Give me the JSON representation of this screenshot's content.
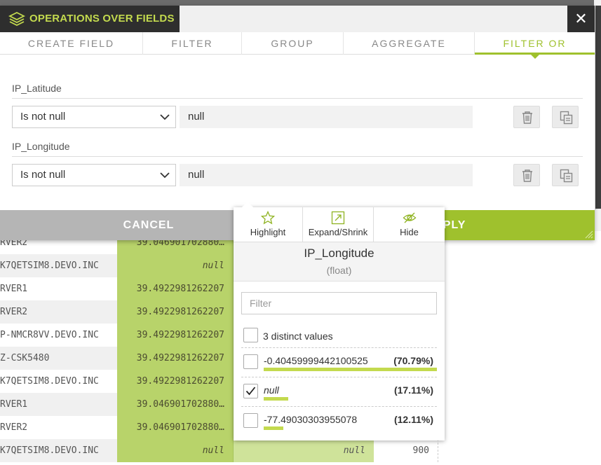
{
  "modal": {
    "title": "OPERATIONS OVER FIELDS",
    "close_symbol": "✕",
    "tabs": [
      {
        "label": "CREATE FIELD",
        "active": false
      },
      {
        "label": "FILTER",
        "active": false
      },
      {
        "label": "GROUP",
        "active": false
      },
      {
        "label": "AGGREGATE",
        "active": false
      },
      {
        "label": "FILTER OR",
        "active": true
      }
    ],
    "filters": [
      {
        "field": "IP_Latitude",
        "operator": "Is not null",
        "value": "null"
      },
      {
        "field": "IP_Longitude",
        "operator": "Is not null",
        "value": "null"
      }
    ],
    "cancel_label": "CANCEL",
    "apply_label": "APPLY"
  },
  "popover": {
    "actions": {
      "highlight": "Highlight",
      "expand": "Expand/Shrink",
      "hide": "Hide"
    },
    "field_name": "IP_Longitude",
    "field_type": "(float)",
    "filter_placeholder": "Filter",
    "distinct_label": "3 distinct values",
    "values": [
      {
        "value": "-0.40459999442100525",
        "percent": "(70.79%)",
        "fraction": 0.7079,
        "checked": false,
        "italic": false
      },
      {
        "value": "null",
        "percent": "(17.11%)",
        "fraction": 0.1711,
        "checked": true,
        "italic": true
      },
      {
        "value": "-77.49030303955078",
        "percent": "(12.11%)",
        "fraction": 0.1211,
        "checked": false,
        "italic": false
      }
    ]
  },
  "grid": {
    "rows": [
      {
        "host": "RVER2",
        "lat": "39.046901702880…",
        "lon": "",
        "extra": ""
      },
      {
        "host": "K7QETSIM8.DEVO.INC",
        "lat": "null",
        "lon": "",
        "extra": ""
      },
      {
        "host": "RVER1",
        "lat": "39.4922981262207",
        "lon": "",
        "extra": ""
      },
      {
        "host": "RVER2",
        "lat": "39.4922981262207",
        "lon": "",
        "extra": ""
      },
      {
        "host": "P-NMCR8VV.DEVO.INC",
        "lat": "39.4922981262207",
        "lon": "",
        "extra": ""
      },
      {
        "host": "Z-CSK5480",
        "lat": "39.4922981262207",
        "lon": "",
        "extra": ""
      },
      {
        "host": "K7QETSIM8.DEVO.INC",
        "lat": "39.4922981262207",
        "lon": "",
        "extra": ""
      },
      {
        "host": "RVER1",
        "lat": "39.046901702880…",
        "lon": "",
        "extra": ""
      },
      {
        "host": "RVER2",
        "lat": "39.046901702880…",
        "lon": "",
        "extra": ""
      },
      {
        "host": "K7QETSIM8.DEVO.INC",
        "lat": "null",
        "lon": "null",
        "extra": "900"
      }
    ]
  },
  "colors": {
    "accent": "#9fc12d",
    "accent_light": "#c3da4e",
    "header_dark": "#2e2e2e",
    "cancel_gray": "#b5b5b5"
  }
}
